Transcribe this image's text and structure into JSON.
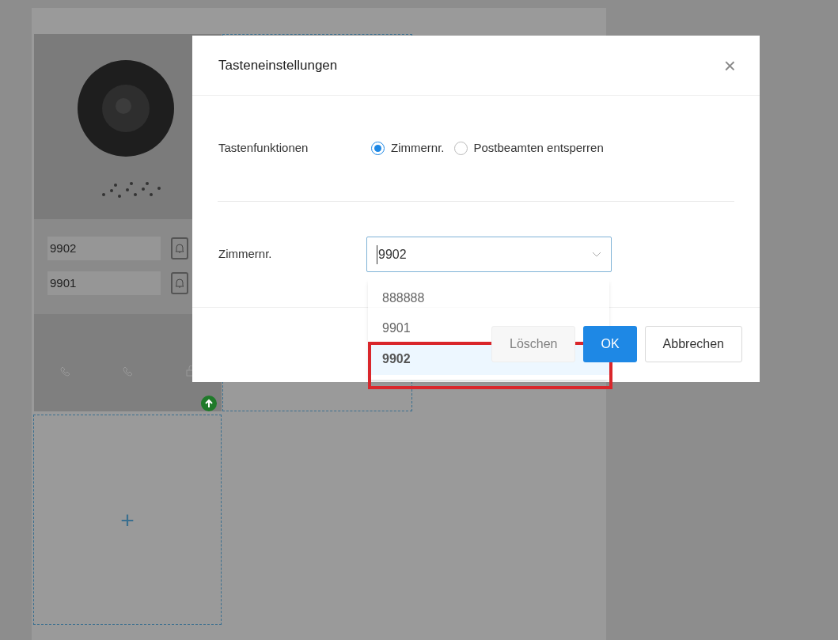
{
  "device_panel": {
    "name_fields": [
      {
        "value": "9902"
      },
      {
        "value": "9901"
      }
    ]
  },
  "add_slot": {
    "label": "+"
  },
  "dialog": {
    "title": "Tasteneinstellungen",
    "close": "×",
    "function_label": "Tastenfunktionen",
    "functions": [
      {
        "label": "Zimmernr.",
        "selected": true
      },
      {
        "label": "Postbeamten entsperren",
        "selected": false
      }
    ],
    "room_label": "Zimmernr.",
    "room_select": {
      "value": "9902",
      "expanded": true,
      "options": [
        {
          "label": "888888",
          "selected": false
        },
        {
          "label": "9901",
          "selected": false
        },
        {
          "label": "9902",
          "selected": true
        }
      ]
    },
    "buttons": [
      {
        "label": "Löschen",
        "kind": "default",
        "disabled": true
      },
      {
        "label": "OK",
        "kind": "primary",
        "disabled": false
      },
      {
        "label": "Abbrechen",
        "kind": "default",
        "disabled": false
      }
    ]
  }
}
